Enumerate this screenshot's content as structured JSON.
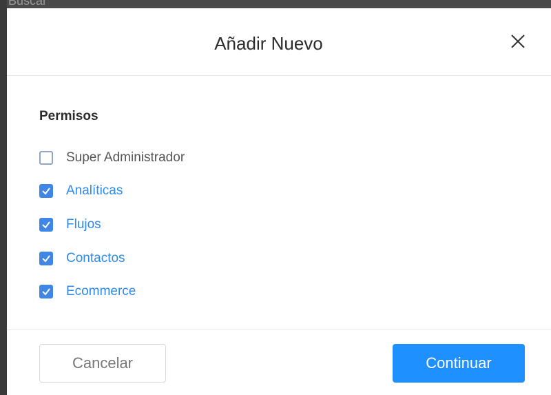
{
  "backdrop": {
    "search_text": "Buscar"
  },
  "modal": {
    "title": "Añadir Nuevo",
    "close_icon": "close-icon",
    "section_title": "Permisos",
    "permissions": [
      {
        "label": "Super Administrador",
        "checked": false
      },
      {
        "label": "Analíticas",
        "checked": true
      },
      {
        "label": "Flujos",
        "checked": true
      },
      {
        "label": "Contactos",
        "checked": true
      },
      {
        "label": "Ecommerce",
        "checked": true
      }
    ],
    "cancel_label": "Cancelar",
    "continue_label": "Continuar"
  },
  "colors": {
    "accent": "#1e90ff",
    "checked_label": "#2f8ae8",
    "checkbox_fill": "#3f86e6"
  }
}
